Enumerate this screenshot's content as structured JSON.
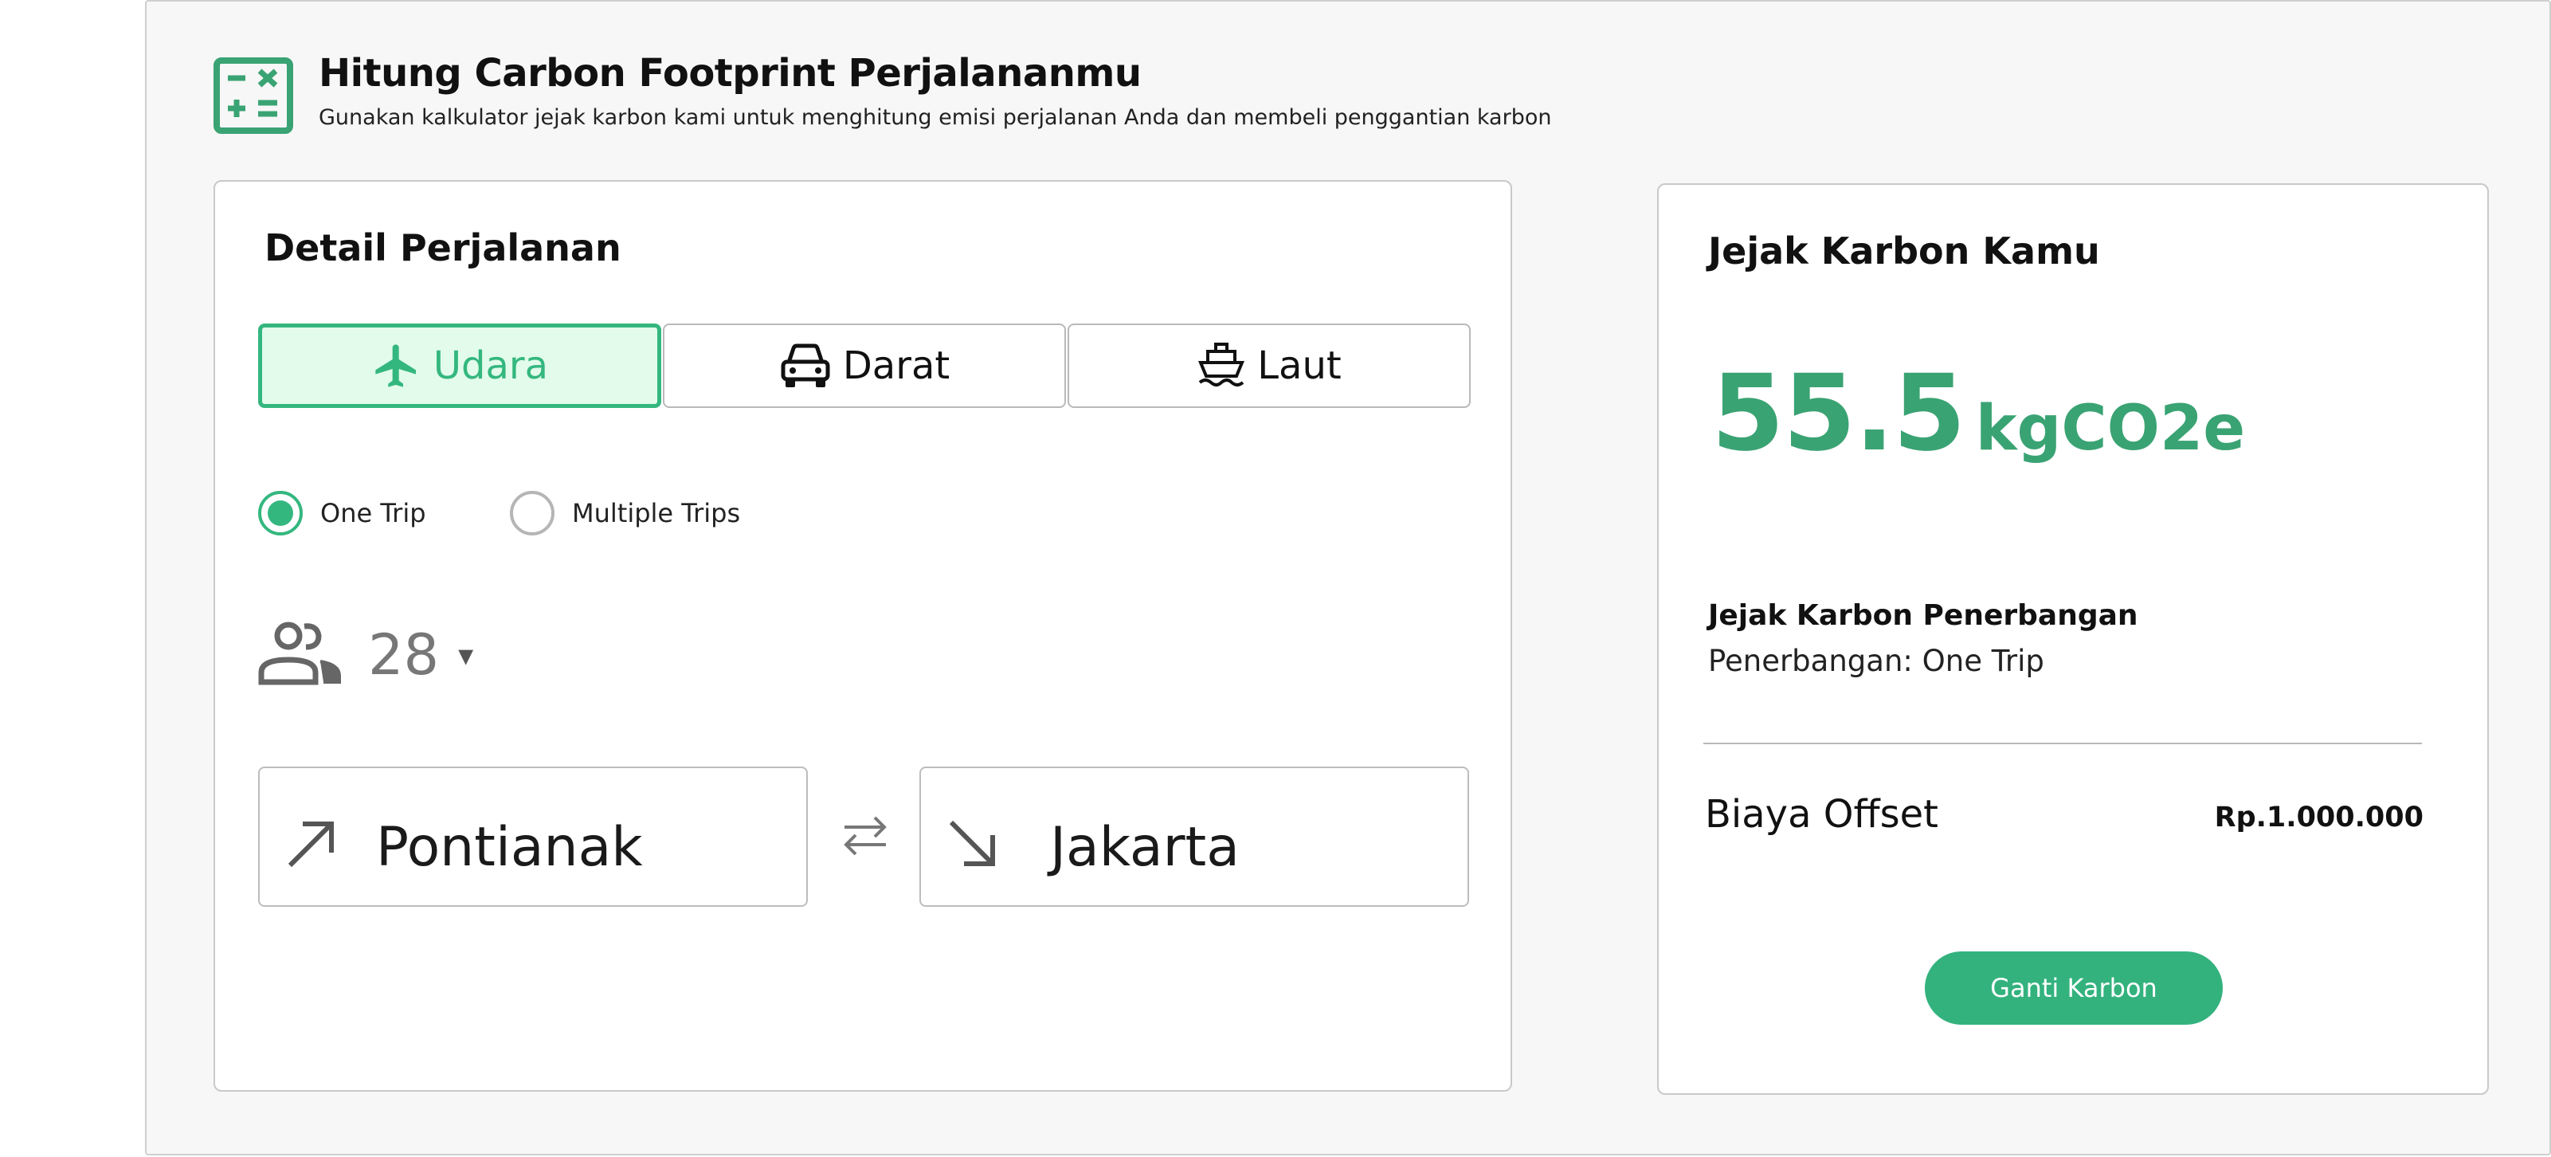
{
  "header": {
    "icon": "calculator-icon",
    "title": "Hitung Carbon Footprint Perjalananmu",
    "subtitle": "Gunakan kalkulator jejak karbon kami untuk menghitung emisi perjalanan Anda dan membeli penggantian karbon"
  },
  "trip_details": {
    "title": "Detail Perjalanan",
    "modes": [
      {
        "label": "Udara",
        "icon": "airplane-icon",
        "active": true
      },
      {
        "label": "Darat",
        "icon": "car-icon",
        "active": false
      },
      {
        "label": "Laut",
        "icon": "ship-icon",
        "active": false
      }
    ],
    "trip_types": [
      {
        "label": "One Trip",
        "selected": true
      },
      {
        "label": "Multiple Trips",
        "selected": false
      }
    ],
    "passengers": {
      "icon": "people-icon",
      "value": "28",
      "caret": "▾"
    },
    "origin": {
      "label": "Pontianak",
      "icon": "arrow-up-right-icon"
    },
    "destination": {
      "label": "Jakarta",
      "icon": "arrow-down-right-icon"
    },
    "swap_icon": "swap-icon"
  },
  "result": {
    "title": "Jejak Karbon Kamu",
    "value": "55.5",
    "unit": "kgCO2e",
    "flight_title": "Jejak Karbon Penerbangan",
    "flight_detail": "Penerbangan: One Trip",
    "offset_label": "Biaya Offset",
    "offset_value": "Rp.1.000.000",
    "cta_label": "Ganti Karbon"
  },
  "colors": {
    "accent": "#34b77f",
    "accent_light": "#e2fbea",
    "panel_bg": "#f7f7f7"
  }
}
